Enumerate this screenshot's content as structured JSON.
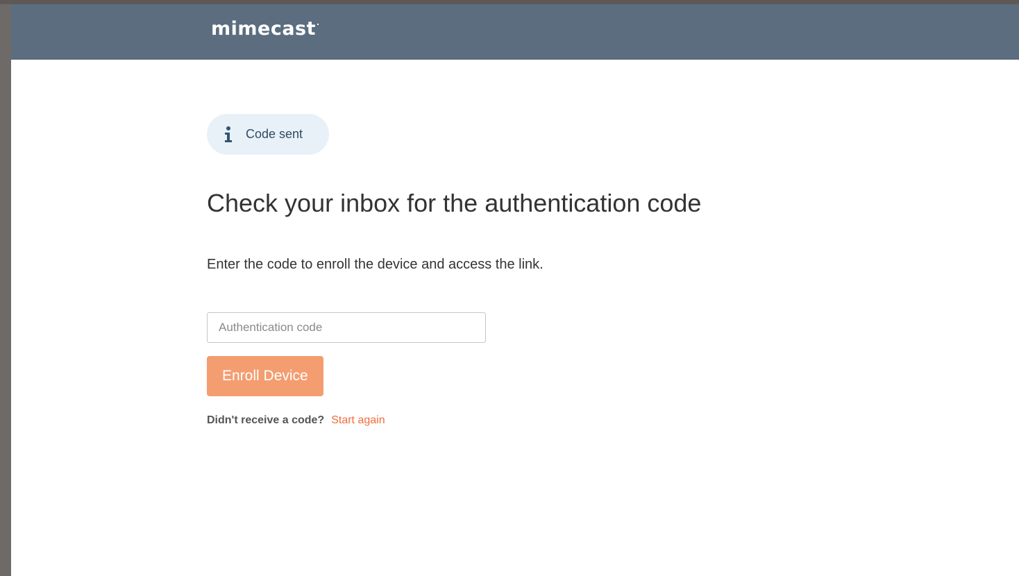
{
  "header": {
    "logo_text": "mimecast"
  },
  "notice": {
    "icon": "info-icon",
    "text": "Code sent"
  },
  "main": {
    "title": "Check your inbox for the authentication code",
    "description": "Enter the code to enroll the device and access the link.",
    "code_input": {
      "placeholder": "Authentication code",
      "value": ""
    },
    "enroll_button_label": "Enroll Device",
    "resend_prompt": "Didn't receive a code?",
    "resend_link": "Start again"
  },
  "colors": {
    "header_bg": "#5b6d7e",
    "badge_bg": "#e9f1f8",
    "button_bg": "#f39d70",
    "link": "#f26c3a"
  }
}
